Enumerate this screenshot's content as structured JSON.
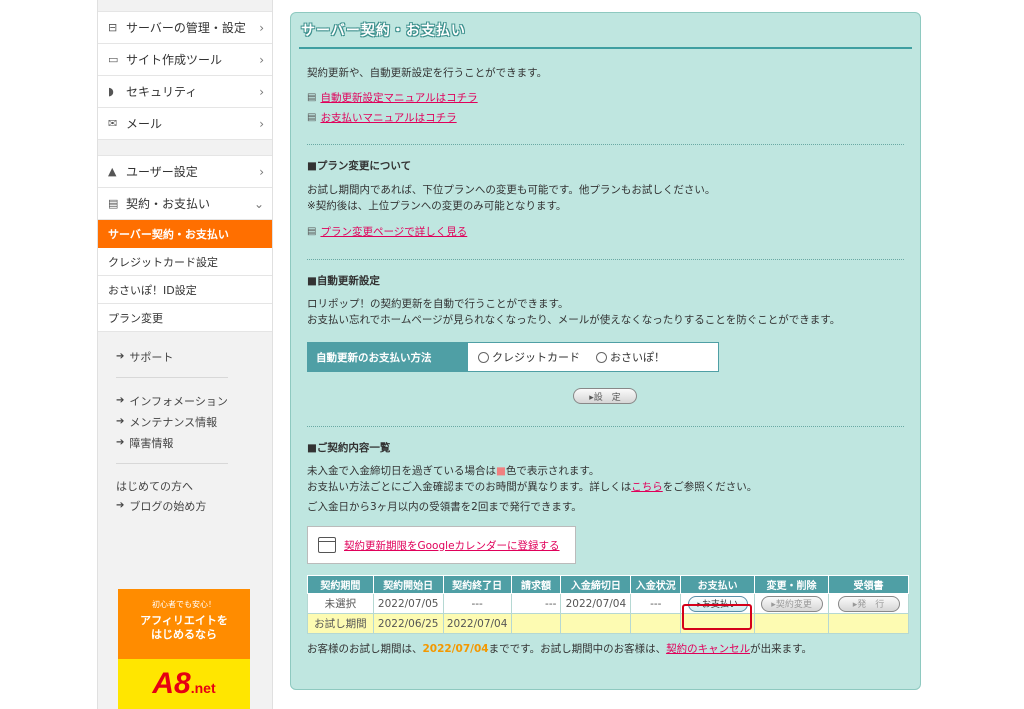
{
  "sidebar": {
    "menu1": [
      {
        "icon": "server-icon",
        "glyph": "⊟",
        "label": "サーバーの管理・設定"
      },
      {
        "icon": "monitor-icon",
        "glyph": "▭",
        "label": "サイト作成ツール"
      },
      {
        "icon": "shield-icon",
        "glyph": "◗",
        "label": "セキュリティ"
      },
      {
        "icon": "mail-icon",
        "glyph": "✉",
        "label": "メール"
      }
    ],
    "menu2": [
      {
        "icon": "user-icon",
        "glyph": "▲",
        "label": "ユーザー設定"
      },
      {
        "icon": "card-icon",
        "glyph": "▤",
        "label": "契約・お支払い"
      }
    ],
    "sub_active": "サーバー契約・お支払い",
    "sub_items": [
      "クレジットカード設定",
      "おさいぽ！ID設定",
      "プラン変更"
    ],
    "links_a": [
      "サポート"
    ],
    "links_b": [
      "インフォメーション",
      "メンテナンス情報",
      "障害情報"
    ],
    "beginner": "はじめての方へ",
    "blog": "ブログの始め方",
    "banner": {
      "t1": "初心者でも安心！",
      "t2a": "アフィリエイトを",
      "t2b": "はじめるなら",
      "logo": "A8",
      "logo_suffix": ".net"
    }
  },
  "panel": {
    "title": "サーバー契約・お支払い",
    "intro": "契約更新や、自動更新設定を行うことができます。",
    "manual1": "自動更新設定マニュアルはコチラ",
    "manual2": "お支払いマニュアルはコチラ",
    "plan": {
      "title": "■プラン変更について",
      "line1": "お試し期間内であれば、下位プランへの変更も可能です。他プランもお試しください。",
      "line2": "※契約後は、上位プランへの変更のみ可能となります。",
      "link": "プラン変更ページで詳しく見る"
    },
    "auto": {
      "title": "■自動更新設定",
      "line1": "ロリポップ！の契約更新を自動で行うことができます。",
      "line2": "お支払い忘れでホームページが見られなくなったり、メールが使えなくなったりすることを防ぐことができます。",
      "label": "自動更新のお支払い方法",
      "opt1": "クレジットカード",
      "opt2": "おさいぽ！",
      "button": "▸設　定"
    },
    "contract": {
      "title": "■ご契約内容一覧",
      "line1a": "未入金で入金締切日を過ぎている場合は",
      "line1b": "■",
      "line1c": "色で表示されます。",
      "line2a": "お支払い方法ごとにご入金確認までのお時間が異なります。詳しくは",
      "line2link": "こちら",
      "line2b": "をご参照ください。",
      "line3": "ご入金日から3ヶ月以内の受領書を2回まで発行できます。",
      "calendar": "契約更新期限をGoogleカレンダーに登録する",
      "headers": [
        "契約期間",
        "契約開始日",
        "契約終了日",
        "請求額",
        "入金締切日",
        "入金状況",
        "お支払い",
        "変更・削除",
        "受領書"
      ],
      "row1": [
        "未選択",
        "2022/07/05",
        "---",
        "---",
        "2022/07/04",
        "---"
      ],
      "row2": [
        "お試し期間",
        "2022/06/25",
        "2022/07/04"
      ],
      "btn_pay": "▸お支払い",
      "btn_change": "▸契約変更",
      "btn_issue": "▸発　行",
      "footer_a": "お客様のお試し期間は、",
      "footer_date": "2022/07/04",
      "footer_b": "までです。お試し期間中のお客様は、",
      "footer_link": "契約のキャンセル",
      "footer_c": "が出来ます。"
    }
  },
  "colors": {
    "accent": "#ff6f00",
    "teal": "#4f9fa5",
    "panel_bg": "#bfe6e0",
    "link": "#e0005a",
    "highlight": "#fdfbb2"
  }
}
